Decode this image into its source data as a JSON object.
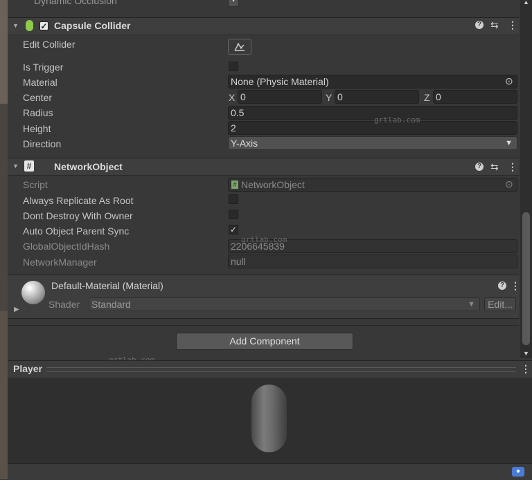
{
  "top_partial": {
    "label": "Dynamic Occlusion"
  },
  "capsule_collider": {
    "title": "Capsule Collider",
    "edit_collider_label": "Edit Collider",
    "is_trigger_label": "Is Trigger",
    "material_label": "Material",
    "material_value": "None (Physic Material)",
    "center_label": "Center",
    "center": {
      "x_label": "X",
      "x": "0",
      "y_label": "Y",
      "y": "0",
      "z_label": "Z",
      "z": "0"
    },
    "radius_label": "Radius",
    "radius": "0.5",
    "height_label": "Height",
    "height": "2",
    "direction_label": "Direction",
    "direction": "Y-Axis"
  },
  "network_object": {
    "title": "NetworkObject",
    "script_label": "Script",
    "script_value": "NetworkObject",
    "always_replicate_label": "Always Replicate As Root",
    "always_replicate": false,
    "dont_destroy_label": "Dont Destroy With Owner",
    "dont_destroy": false,
    "auto_parent_label": "Auto Object Parent Sync",
    "auto_parent": true,
    "hash_label": "GlobalObjectIdHash",
    "hash_value": "2206645839",
    "manager_label": "NetworkManager",
    "manager_value": "null"
  },
  "material": {
    "title": "Default-Material (Material)",
    "shader_label": "Shader",
    "shader_value": "Standard",
    "edit_label": "Edit..."
  },
  "add_component_label": "Add Component",
  "preview": {
    "title": "Player"
  },
  "watermark": "grtlab.com",
  "icons": {
    "checkmark": "✓",
    "help": "?",
    "settings": "⇆",
    "menu": "⋮",
    "foldout": "▼",
    "script": "#",
    "target": "⊙",
    "chevron": "▾",
    "tag": "🏷"
  },
  "colors": {
    "accent": "#4a7bd8",
    "collider_icon": "#8ecb4b"
  }
}
